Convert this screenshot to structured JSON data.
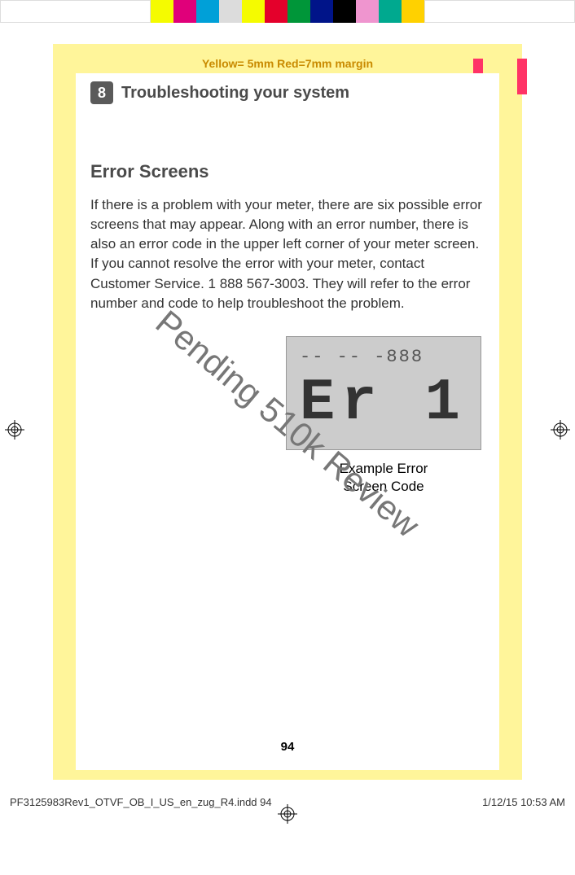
{
  "colorbar": [
    "#ffffff",
    "#f5fb00",
    "#e0007a",
    "#00a0d8",
    "#dcdcdc",
    "#f5fb00",
    "#e4002b",
    "#009639",
    "#001489",
    "#000000",
    "#ef95cf",
    "#00a98f",
    "#ffd100",
    "#ffffff"
  ],
  "marginNote": "Yellow= 5mm  Red=7mm margin",
  "chapter": {
    "number": "8",
    "title": "Troubleshooting your system"
  },
  "section": {
    "title": "Error Screens"
  },
  "body": "If there is a problem with your meter, there are six possible error screens that may appear. Along with an error number, there is also an error code in the upper left corner of your meter screen. If you cannot resolve the error with your meter, contact Customer Service. 1 888 567-3003. They will refer to the error number and code to help troubleshoot the problem.",
  "lcd": {
    "topline": "-- -- -888",
    "main": "Er 1",
    "caption1": "Example Error",
    "caption2": "Screen Code"
  },
  "watermark": "Pending 510k Review",
  "pageNumber": "94",
  "slug": {
    "file": "PF3125983Rev1_OTVF_OB_I_US_en_zug_R4.indd   94",
    "datetime": "1/12/15   10:53 AM"
  }
}
